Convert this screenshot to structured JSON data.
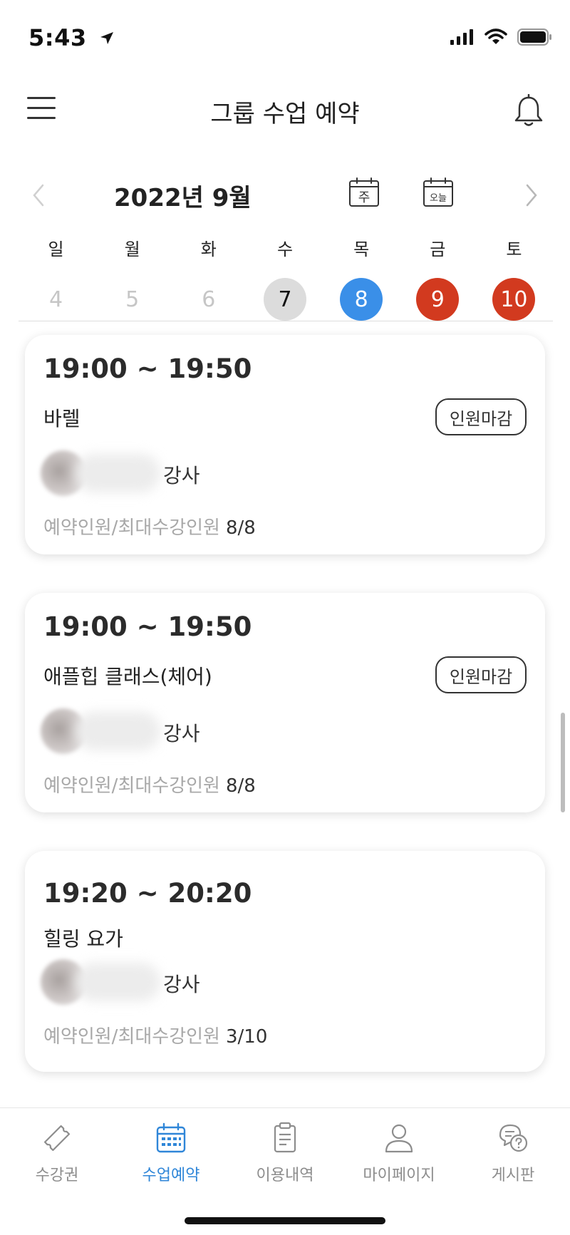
{
  "status_bar": {
    "time": "5:43"
  },
  "header": {
    "title": "그룹 수업 예약"
  },
  "calendar": {
    "month_label": "2022년 9월",
    "week_icon_label": "주",
    "today_icon_label": "오늘",
    "weekdays": [
      "일",
      "월",
      "화",
      "수",
      "목",
      "금",
      "토"
    ],
    "dates": [
      "4",
      "5",
      "6",
      "7",
      "8",
      "9",
      "10"
    ]
  },
  "classes": [
    {
      "time": "19:00 ~ 19:50",
      "name": "바렐",
      "badge": "인원마감",
      "instructor_suffix": "강사",
      "capacity_label": "예약인원/최대수강인원",
      "capacity_value": "8/8"
    },
    {
      "time": "19:00 ~ 19:50",
      "name": "애플힙 클래스(체어)",
      "badge": "인원마감",
      "instructor_suffix": "강사",
      "capacity_label": "예약인원/최대수강인원",
      "capacity_value": "8/8"
    },
    {
      "time": "19:20 ~ 20:20",
      "name": "힐링 요가",
      "instructor_suffix": "강사",
      "capacity_label": "예약인원/최대수강인원",
      "capacity_value": "3/10"
    }
  ],
  "tabs": [
    {
      "label": "수강권",
      "icon": "ticket-icon"
    },
    {
      "label": "수업예약",
      "icon": "calendar-icon"
    },
    {
      "label": "이용내역",
      "icon": "clipboard-icon"
    },
    {
      "label": "마이페이지",
      "icon": "person-icon"
    },
    {
      "label": "게시판",
      "icon": "chat-question-icon"
    }
  ],
  "colors": {
    "accent": "#2f86d8",
    "today_blue": "#3a8fe8",
    "weekend_red": "#d23a1f",
    "selected_gray": "#dcdcdc"
  }
}
